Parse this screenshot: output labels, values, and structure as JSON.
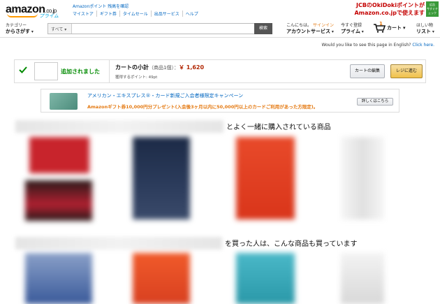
{
  "header": {
    "logo_text": "amazon",
    "logo_suffix": ".co.jp",
    "logo_prime": "プライム",
    "toplinks_row1": "Amazonポイント 残高を確認",
    "toplinks_row2": [
      "マイストア",
      "ギフト券",
      "タイムセール",
      "出品サービス",
      "ヘルプ"
    ],
    "promo_line1": "JCBのOkiDokiポイントが",
    "promo_line2": "Amazon.co.jpで使えます",
    "promo_badge": "今すぐチェック",
    "promo_badge_top": "広告"
  },
  "nav": {
    "category_small": "カテゴリー",
    "category_main": "からさがす",
    "search_scope": "すべて",
    "search_placeholder": "",
    "search_button": "検索",
    "account_greeting": "こんにちは。",
    "account_signin": "サインイン",
    "account_main": "アカウントサービス",
    "prime_small": "今すぐ登録",
    "prime_main": "プライム",
    "cart_count": "1",
    "cart_label": "カート",
    "wish_small": "ほしい物",
    "wish_main": "リスト"
  },
  "english_prompt": "Would you like to see this page in English?",
  "english_link": "Click here.",
  "added": {
    "message": "追加されました",
    "subtotal_label": "カートの小計",
    "subtotal_items": "（商品1個）：",
    "subtotal_price": "￥ 1,620",
    "points": "獲得するポイント: 49pt",
    "edit_button": "カートの編集",
    "checkout_button": "レジに進む"
  },
  "card_banner": {
    "title": "アメリカン・エキスプレス®・カード新規ご入会者様限定キャンペーン",
    "offer": "Amazonギフト券10,000円分プレゼント(入会後3ヶ月以内に50,000円以上のカードご利用があった方限定)。",
    "button": "詳しくはこちら"
  },
  "sections": [
    {
      "title": "とよく一緒に購入されている商品"
    },
    {
      "title": "を買った人は、こんな商品も買っています"
    }
  ],
  "colors": {
    "accent_orange": "#e47911",
    "link_blue": "#0066c0",
    "price_red": "#b12704",
    "success_green": "#008a00"
  }
}
